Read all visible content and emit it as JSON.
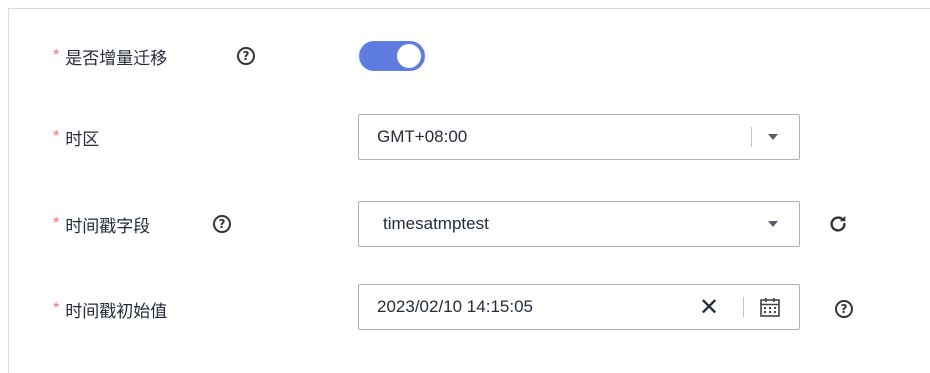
{
  "form": {
    "incremental": {
      "label": "是否增量迁移",
      "required_mark": "*",
      "enabled": true
    },
    "timezone": {
      "label": "时区",
      "required_mark": "*",
      "value": "GMT+08:00"
    },
    "timestamp_field": {
      "label": "时间戳字段",
      "required_mark": "*",
      "value": "timesatmptest"
    },
    "timestamp_initial": {
      "label": "时间戳初始值",
      "required_mark": "*",
      "value": "2023/02/10 14:15:05"
    }
  },
  "help_glyph": "?",
  "clear_glyph": "✕",
  "colors": {
    "accent": "#5e7ce0",
    "required": "#f66f6a",
    "text": "#252b3a"
  },
  "icons": [
    "help-icon",
    "chevron-down-icon",
    "refresh-icon",
    "close-icon",
    "calendar-icon"
  ]
}
